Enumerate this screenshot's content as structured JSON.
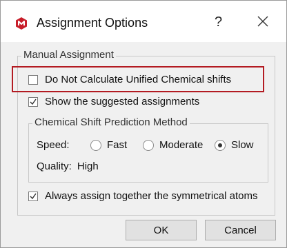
{
  "window": {
    "title": "Assignment Options",
    "help_label": "?",
    "app_icon": "app-logo-icon",
    "close_icon": "close-icon"
  },
  "manual_group": {
    "legend": "Manual Assignment",
    "do_not_calculate": {
      "label": "Do Not Calculate Unified Chemical shifts",
      "checked": false
    },
    "show_suggested": {
      "label": "Show the suggested assignments",
      "checked": true
    }
  },
  "prediction_group": {
    "legend": "Chemical Shift Prediction Method",
    "speed_label": "Speed:",
    "speed_options": [
      {
        "label": "Fast",
        "selected": false
      },
      {
        "label": "Moderate",
        "selected": false
      },
      {
        "label": "Slow",
        "selected": true
      }
    ],
    "quality_label": "Quality:",
    "quality_value": "High"
  },
  "always_assign": {
    "label": "Always assign together the symmetrical atoms",
    "checked": true
  },
  "buttons": {
    "ok": "OK",
    "cancel": "Cancel"
  },
  "colors": {
    "highlight": "#b31b22",
    "app_icon": "#c81e2a"
  }
}
